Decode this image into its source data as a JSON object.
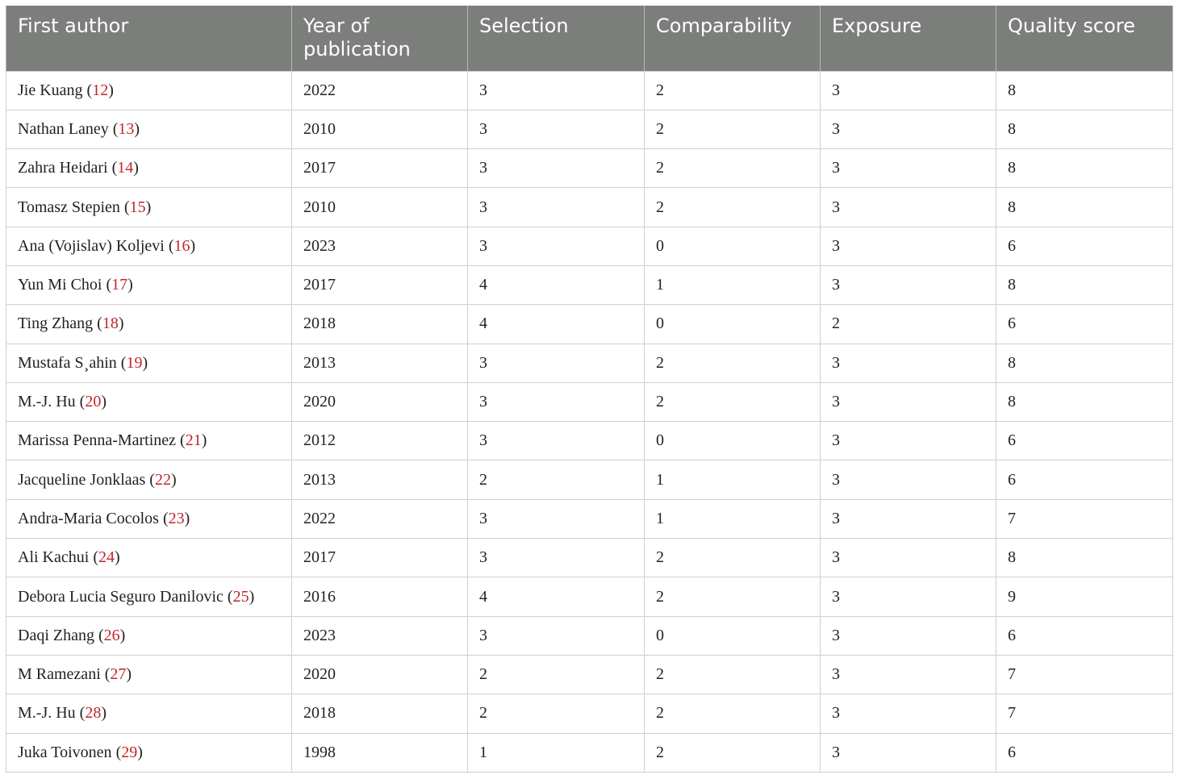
{
  "table": {
    "headers": [
      "First author",
      "Year of publication",
      "Selection",
      "Comparability",
      "Exposure",
      "Quality score"
    ],
    "rows": [
      {
        "author": "Jie Kuang",
        "ref": "12",
        "year": "2022",
        "selection": "3",
        "comparability": "2",
        "exposure": "3",
        "quality": "8"
      },
      {
        "author": "Nathan Laney",
        "ref": "13",
        "year": "2010",
        "selection": "3",
        "comparability": "2",
        "exposure": "3",
        "quality": "8"
      },
      {
        "author": "Zahra Heidari",
        "ref": "14",
        "year": "2017",
        "selection": "3",
        "comparability": "2",
        "exposure": "3",
        "quality": "8"
      },
      {
        "author": "Tomasz Stepien",
        "ref": "15",
        "year": "2010",
        "selection": "3",
        "comparability": "2",
        "exposure": "3",
        "quality": "8"
      },
      {
        "author": "Ana (Vojislav) Koljevi",
        "ref": "16",
        "year": "2023",
        "selection": "3",
        "comparability": "0",
        "exposure": "3",
        "quality": "6"
      },
      {
        "author": "Yun Mi Choi",
        "ref": "17",
        "year": "2017",
        "selection": "4",
        "comparability": "1",
        "exposure": "3",
        "quality": "8"
      },
      {
        "author": "Ting Zhang",
        "ref": "18",
        "year": "2018",
        "selection": "4",
        "comparability": "0",
        "exposure": "2",
        "quality": "6"
      },
      {
        "author": "Mustafa S¸ahin",
        "ref": "19",
        "year": "2013",
        "selection": "3",
        "comparability": "2",
        "exposure": "3",
        "quality": "8"
      },
      {
        "author": "M.-J. Hu",
        "ref": "20",
        "year": "2020",
        "selection": "3",
        "comparability": "2",
        "exposure": "3",
        "quality": "8"
      },
      {
        "author": "Marissa Penna-Martinez",
        "ref": "21",
        "year": "2012",
        "selection": "3",
        "comparability": "0",
        "exposure": "3",
        "quality": "6"
      },
      {
        "author": "Jacqueline Jonklaas",
        "ref": "22",
        "year": "2013",
        "selection": "2",
        "comparability": "1",
        "exposure": "3",
        "quality": "6"
      },
      {
        "author": "Andra-Maria Cocolos",
        "ref": "23",
        "year": "2022",
        "selection": "3",
        "comparability": "1",
        "exposure": "3",
        "quality": "7"
      },
      {
        "author": "Ali Kachui",
        "ref": "24",
        "year": "2017",
        "selection": "3",
        "comparability": "2",
        "exposure": "3",
        "quality": "8"
      },
      {
        "author": "Debora Lucia Seguro Danilovic",
        "ref": "25",
        "year": "2016",
        "selection": "4",
        "comparability": "2",
        "exposure": "3",
        "quality": "9"
      },
      {
        "author": "Daqi Zhang",
        "ref": "26",
        "year": "2023",
        "selection": "3",
        "comparability": "0",
        "exposure": "3",
        "quality": "6"
      },
      {
        "author": "M Ramezani",
        "ref": "27",
        "year": "2020",
        "selection": "2",
        "comparability": "2",
        "exposure": "3",
        "quality": "7"
      },
      {
        "author": "M.-J. Hu",
        "ref": "28",
        "year": "2018",
        "selection": "2",
        "comparability": "2",
        "exposure": "3",
        "quality": "7"
      },
      {
        "author": "Juka Toivonen",
        "ref": "29",
        "year": "1998",
        "selection": "1",
        "comparability": "2",
        "exposure": "3",
        "quality": "6"
      }
    ]
  },
  "colors": {
    "header_bg": "#7c7e7c",
    "header_text": "#ffffff",
    "reference_link": "#c0262b",
    "grid_line": "#cfcfcf"
  }
}
